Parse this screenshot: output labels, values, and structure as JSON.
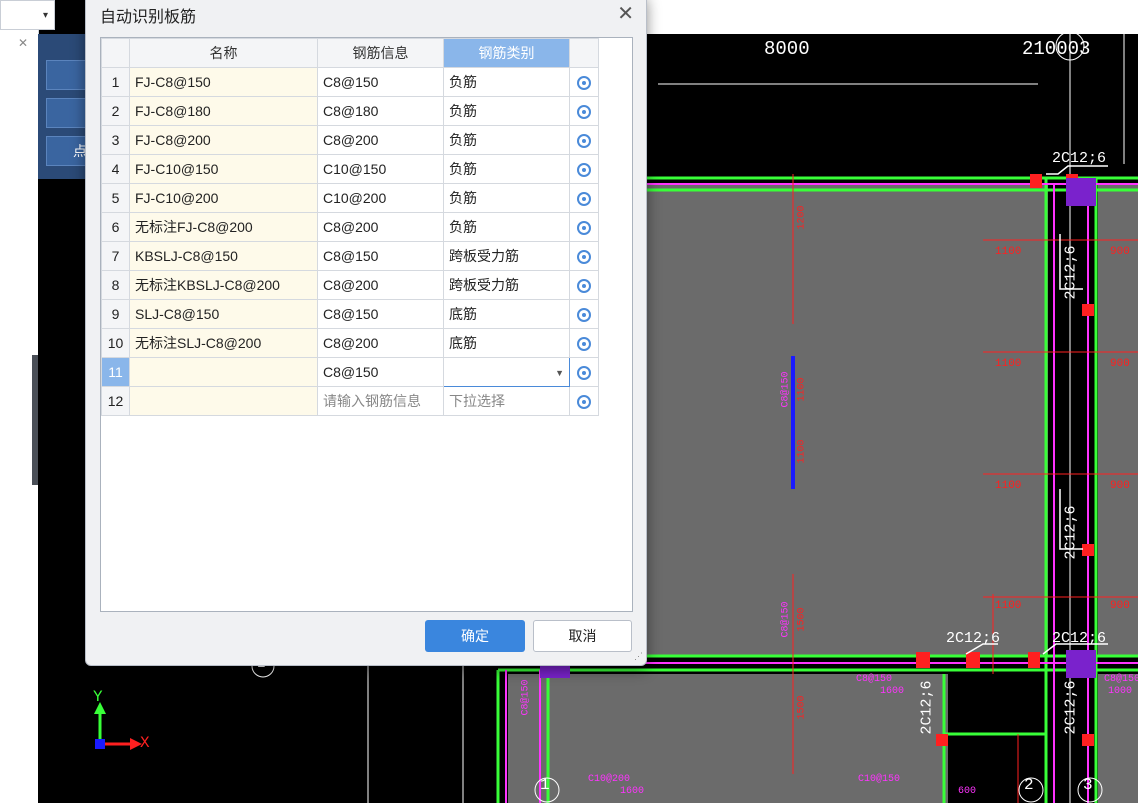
{
  "dialog": {
    "title": "自动识别板筋",
    "close_icon": "close-icon",
    "columns": [
      "名称",
      "钢筋信息",
      "钢筋类别"
    ],
    "rows": [
      {
        "num": "1",
        "name": "FJ-C8@150",
        "info": "C8@150",
        "category": "负筋"
      },
      {
        "num": "2",
        "name": "FJ-C8@180",
        "info": "C8@180",
        "category": "负筋"
      },
      {
        "num": "3",
        "name": "FJ-C8@200",
        "info": "C8@200",
        "category": "负筋"
      },
      {
        "num": "4",
        "name": "FJ-C10@150",
        "info": "C10@150",
        "category": "负筋"
      },
      {
        "num": "5",
        "name": "FJ-C10@200",
        "info": "C10@200",
        "category": "负筋"
      },
      {
        "num": "6",
        "name": "无标注FJ-C8@200",
        "info": "C8@200",
        "category": "负筋"
      },
      {
        "num": "7",
        "name": "KBSLJ-C8@150",
        "info": "C8@150",
        "category": "跨板受力筋"
      },
      {
        "num": "8",
        "name": "无标注KBSLJ-C8@200",
        "info": "C8@200",
        "category": "跨板受力筋"
      },
      {
        "num": "9",
        "name": "SLJ-C8@150",
        "info": "C8@150",
        "category": "底筋"
      },
      {
        "num": "10",
        "name": "无标注SLJ-C8@200",
        "info": "C8@200",
        "category": "底筋"
      },
      {
        "num": "11",
        "name": "",
        "info": "C8@150",
        "category": ""
      },
      {
        "num": "12",
        "name": "",
        "info": "请输入钢筋信息",
        "category": "下拉选择"
      }
    ],
    "ok_label": "确定",
    "cancel_label": "取消"
  },
  "left_panel": {
    "button_label": "点"
  },
  "cad": {
    "axis_x": "X",
    "axis_y": "Y",
    "dim_top_left": "8000",
    "dim_top_right": "210003",
    "labels": {
      "rebar_a": "2C12;6",
      "rebar_b": "2C12;6",
      "rebar_c": "2C12;6",
      "rebar_d": "2C12;6",
      "rebar_e": "2C12;6",
      "rebar_f": "2C12;6",
      "rebar_g": "2C12;6",
      "rebar_h": "2C12;6",
      "dim_1100_a": "1100",
      "dim_1100_b": "1100",
      "dim_1100_c": "1100",
      "dim_1100_d": "1100",
      "dim_900_a": "900",
      "dim_900_b": "900",
      "dim_900_c": "900",
      "dim_900_d": "900",
      "dim_1200": "1200",
      "dim_1100_v1": "1100",
      "dim_1100_v2": "1100",
      "dim_1500_a": "1500",
      "dim_1500_b": "1500",
      "bar_c8150_a": "C8@150",
      "bar_c8150_b": "C8@150",
      "bar_c8150_c": "C8@150",
      "bar_c8150_d": "C8@150",
      "bar_c8150_e": "C8@150",
      "bar_c10200": "C10@200",
      "bar_c10150": "C10@150",
      "dim_1600_a": "1600",
      "dim_1600_b": "1600",
      "dim_1000": "1000",
      "dim_1500_c": "1500",
      "dim_600_a": "600",
      "dim_600_b": "600",
      "axis_1": "1",
      "axis_2": "2",
      "axis_3": "3",
      "axis_e": "E"
    },
    "colors": {
      "slab_fill": "#6b6b6b",
      "beam_green": "#38ff38",
      "beam_magenta": "#ff33ff",
      "rebar_red": "#ff2020",
      "dim_white": "#ffffff",
      "blue_rebar": "#1a1aff"
    }
  }
}
